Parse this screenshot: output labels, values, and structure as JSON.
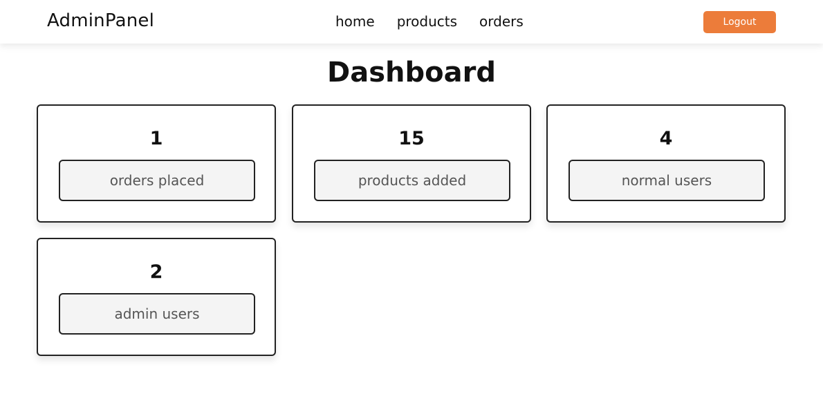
{
  "header": {
    "brand": "AdminPanel",
    "nav": [
      {
        "label": "home"
      },
      {
        "label": "products"
      },
      {
        "label": "orders"
      }
    ],
    "logout_label": "Logout"
  },
  "main": {
    "title": "Dashboard",
    "cards": [
      {
        "value": "1",
        "label": "orders placed"
      },
      {
        "value": "15",
        "label": "products added"
      },
      {
        "value": "4",
        "label": "normal users"
      },
      {
        "value": "2",
        "label": "admin users"
      }
    ]
  },
  "colors": {
    "accent": "#ec7c3a",
    "card_label_bg": "#f4f4f4",
    "border": "#222222"
  }
}
